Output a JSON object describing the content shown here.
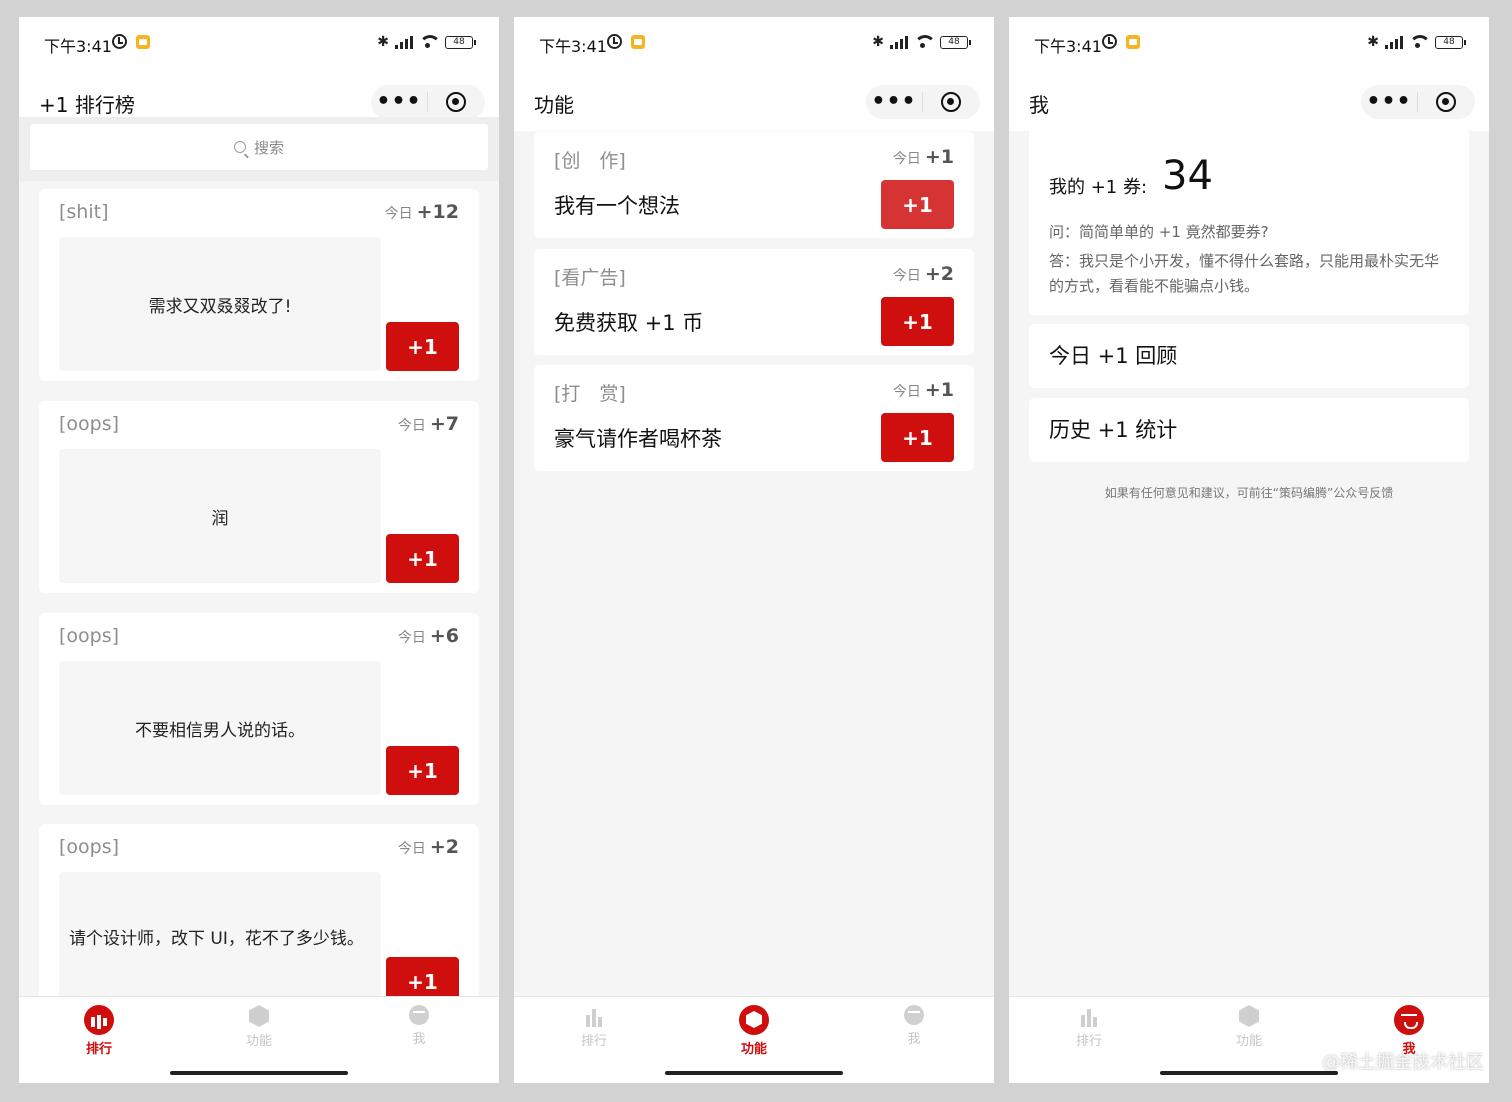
{
  "status": {
    "time": "下午3:41",
    "battery": "48",
    "bluetooth": "✱"
  },
  "capsule": {
    "more": "•••"
  },
  "tabs": {
    "rank": "排行",
    "func": "功能",
    "me": "我"
  },
  "rank": {
    "title": "+1 排行榜",
    "search_placeholder": "搜索",
    "today_label": "今日",
    "plus_label": "+1",
    "items": [
      {
        "tag": "[shit]",
        "count": "+12",
        "text": "需求又双叒叕改了!"
      },
      {
        "tag": "[oops]",
        "count": "+7",
        "text": "润"
      },
      {
        "tag": "[oops]",
        "count": "+6",
        "text": "不要相信男人说的话。"
      },
      {
        "tag": "[oops]",
        "count": "+2",
        "text": "请个设计师，改下 UI，花不了多少钱。"
      }
    ]
  },
  "func": {
    "title": "功能",
    "today_label": "今日",
    "plus_label": "+1",
    "items": [
      {
        "tag": "[创　作]",
        "count": "+1",
        "title": "我有一个想法"
      },
      {
        "tag": "[看广告]",
        "count": "+2",
        "title": "免费获取 +1 币"
      },
      {
        "tag": "[打　赏]",
        "count": "+1",
        "title": "豪气请作者喝杯茶"
      }
    ]
  },
  "me": {
    "title": "我",
    "coupon_label": "我的 +1 券:",
    "coupon_count": "34",
    "question": "问：简简单单的 +1 竟然都要券?",
    "answer": "答：我只是个小开发，懂不得什么套路，只能用最朴实无华的方式，看看能不能骗点小钱。",
    "today_review": "今日 +1 回顾",
    "history_stats": "历史 +1 统计",
    "feedback": "如果有任何意见和建议，可前往“策码编腾”公众号反馈"
  },
  "watermark": "@稀土掘金技术社区",
  "colors": {
    "accent": "#cf0e0e",
    "background": "#f5f5f5"
  }
}
